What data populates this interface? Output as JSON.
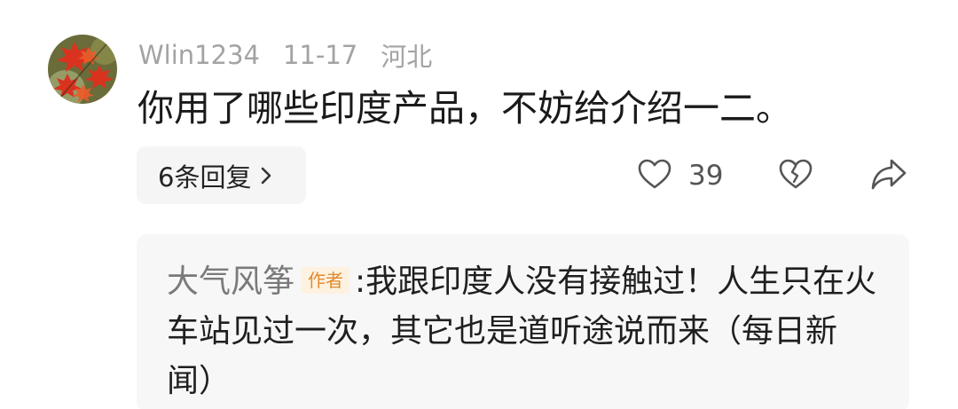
{
  "comment": {
    "username": "Wlin1234",
    "date": "11-17",
    "location": "河北",
    "text": "你用了哪些印度产品，不妨给介绍一二。",
    "replies_label": "6条回复",
    "like_count": "39"
  },
  "reply": {
    "author": "大气风筝",
    "badge": "作者",
    "separator": ":",
    "text": "我跟印度人没有接触过！人生只在火车站见过一次，其它也是道听途说而来（每日新闻）"
  },
  "icons": {
    "avatar": "red-maple-leaves-avatar",
    "replies_chevron": "chevron-right-icon",
    "like": "heart-outline-icon",
    "dislike": "broken-heart-icon",
    "share": "share-arrow-icon"
  },
  "colors": {
    "meta_gray": "#a3a3a3",
    "badge_bg": "#fdf1e0",
    "badge_text": "#e08a2d",
    "reply_bg": "#f7f7f7"
  }
}
